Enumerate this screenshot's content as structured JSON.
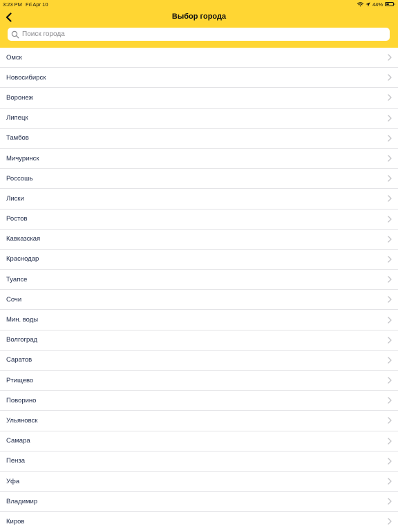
{
  "status_bar": {
    "time": "3:23 PM",
    "date": "Fri Apr 10",
    "battery_percent": "44%",
    "battery_level": 0.44,
    "icons": [
      "wifi-icon",
      "location-arrow-icon",
      "battery-icon"
    ]
  },
  "nav": {
    "title": "Выбор города",
    "back_icon": "chevron-left-icon"
  },
  "search": {
    "placeholder": "Поиск города",
    "value": "",
    "icon": "search-icon"
  },
  "colors": {
    "header_bg": "#FFD633",
    "city_text": "#1f2a48",
    "separator": "#e3e3e6",
    "chevron": "#c4c4c7",
    "placeholder": "#8a8a8e"
  },
  "cities": [
    "Омск",
    "Новосибирск",
    "Воронеж",
    "Липецк",
    "Тамбов",
    "Мичуринск",
    "Россошь",
    "Лиски",
    "Ростов",
    "Кавказская",
    "Краснодар",
    "Туапсе",
    "Сочи",
    "Мин. воды",
    "Волгоград",
    "Саратов",
    "Ртищево",
    "Поворино",
    "Ульяновск",
    "Самара",
    "Пенза",
    "Уфа",
    "Владимир",
    "Киров"
  ]
}
